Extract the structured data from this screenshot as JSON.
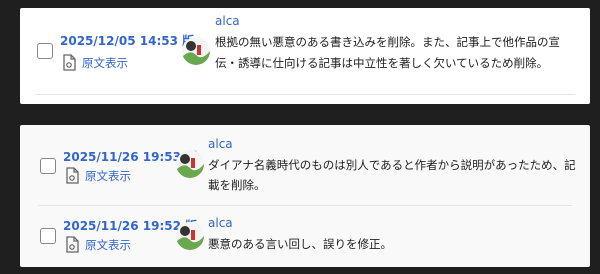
{
  "revisions": [
    {
      "date": "2025/12/05 14:53 版",
      "diff_label": "原文表示",
      "user": "alca",
      "summary_lines": [
        "根拠の無い悪意のある書き込みを削除。また、記事上で他作品の宣",
        "伝・誘導に仕向ける記事は中立性を著しく欠いているため削除。"
      ]
    },
    {
      "date": "2025/11/26 19:53 版",
      "diff_label": "原文表示",
      "user": "alca",
      "summary_lines": [
        "ダイアナ名義時代のものは別人であると作者から説明があったため、記",
        "載を削除。"
      ]
    },
    {
      "date": "2025/11/26 19:52 版",
      "diff_label": "原文表示",
      "user": "alca",
      "summary_lines": [
        "悪意のある言い回し、誤りを修正。"
      ]
    }
  ],
  "icons": {
    "diff": "document-icon",
    "avatar": "user-avatar"
  },
  "colors": {
    "link": "#3366cc",
    "text": "#202122",
    "background": "#1f1f1f"
  }
}
